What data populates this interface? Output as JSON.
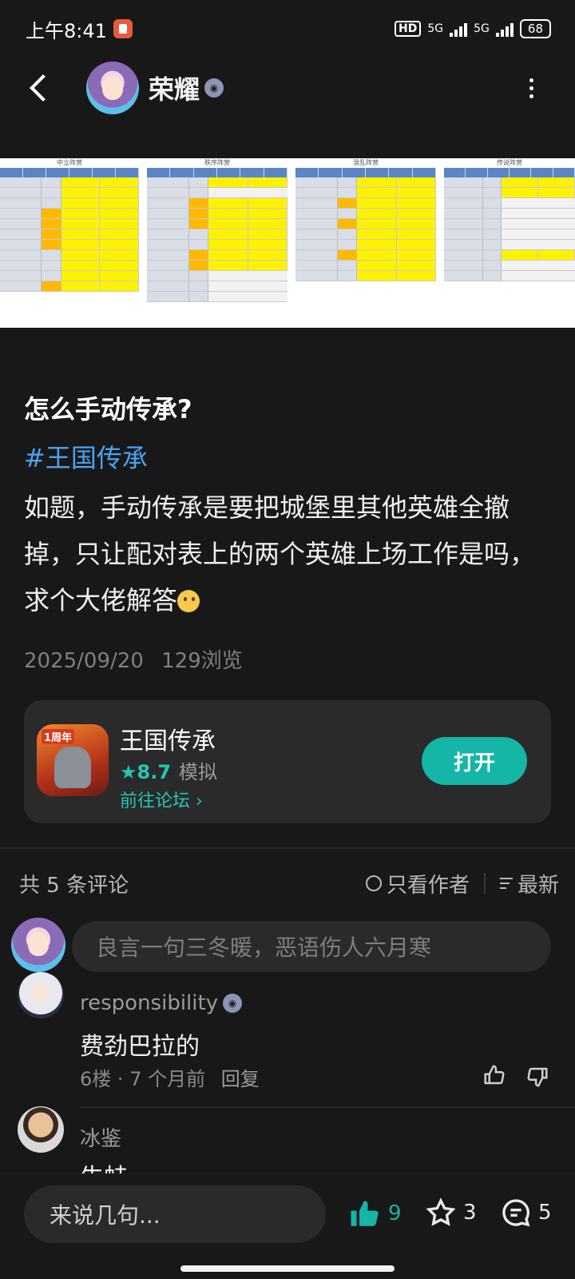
{
  "status_bar": {
    "time": "上午8:41",
    "hd": "HD",
    "net1": "5G",
    "net2": "5G",
    "battery": "68"
  },
  "header": {
    "username": "荣耀",
    "game_badge_icon": "gamepad-icon"
  },
  "image_tables": [
    {
      "title": "中立阵营"
    },
    {
      "title": "秩序阵营"
    },
    {
      "title": "混乱阵营"
    },
    {
      "title": "传说阵营"
    }
  ],
  "post": {
    "title": "怎么手动传承?",
    "tag": "#王国传承",
    "body": "如题，手动传承是要把城堡里其他英雄全撤掉，只让配对表上的两个英雄上场工作是吗，求个大佬解答",
    "date": "2025/09/20",
    "views": "129浏览"
  },
  "game_card": {
    "anniversary": "1周年",
    "name": "王国传承",
    "rating": "8.7",
    "category": "模拟",
    "forum_link": "前往论坛 ›",
    "open_label": "打开"
  },
  "comments_section": {
    "count_label": "共 5 条评论",
    "only_author": "只看作者",
    "sort": "最新",
    "input_placeholder": "良言一句三冬暖，恶语伤人六月寒"
  },
  "comments": [
    {
      "user": "responsibility",
      "text": "费劲巴拉的",
      "floor": "6楼",
      "time": "7 个月前",
      "reply": "回复"
    },
    {
      "user": "冰鉴",
      "text": "牛蛙"
    }
  ],
  "bottom_bar": {
    "input_placeholder": "来说几句...",
    "likes": "9",
    "favorites": "3",
    "comments": "5"
  },
  "colors": {
    "accent": "#15b5a7",
    "tag": "#4aa3f0",
    "background": "#181818"
  }
}
